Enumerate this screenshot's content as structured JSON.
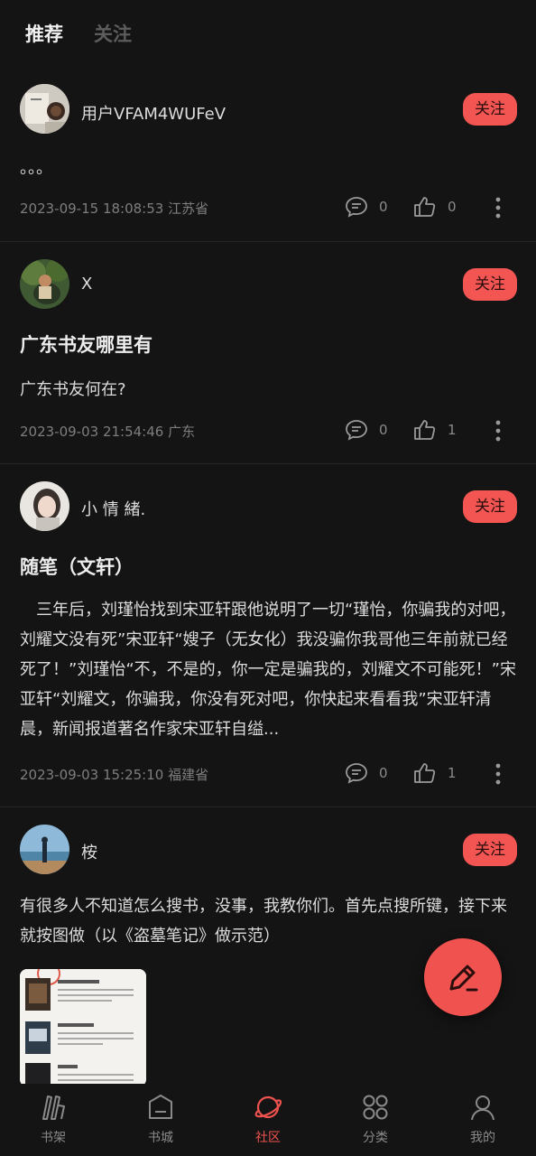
{
  "tabs": {
    "recommend": "推荐",
    "follow": "关注"
  },
  "follow_label": "关注",
  "posts": [
    {
      "user": "用户VFAM4WUFeV",
      "body": "。。。",
      "time": "2023-09-15 18:08:53 江苏省",
      "comments": "0",
      "likes": "0"
    },
    {
      "user": "X",
      "title": "广东书友哪里有",
      "body": "广东书友何在?",
      "time": "2023-09-03 21:54:46 广东",
      "comments": "0",
      "likes": "1"
    },
    {
      "user": "小 情 緒.",
      "title": "随笔（文轩）",
      "body": "　三年后，刘瑾怡找到宋亚轩跟他说明了一切“瑾怡，你骗我的对吧，刘耀文没有死”宋亚轩“嫂子（无女化）我没骗你我哥他三年前就已经死了！”刘瑾怡“不，不是的，你一定是骗我的，刘耀文不可能死！”宋亚轩“刘耀文，你骗我，你没有死对吧，你快起来看看我”宋亚轩清晨，新闻报道著名作家宋亚轩自缢...",
      "time": "2023-09-03 15:25:10 福建省",
      "comments": "0",
      "likes": "1"
    },
    {
      "user": "桉",
      "body": "有很多人不知道怎么搜书，没事，我教你们。首先点搜所键，接下来就按图做（以《盗墓笔记》做示范）"
    }
  ],
  "nav": [
    {
      "label": "书架",
      "icon": "bookshelf-icon"
    },
    {
      "label": "书城",
      "icon": "bookstore-icon"
    },
    {
      "label": "社区",
      "icon": "planet-icon"
    },
    {
      "label": "分类",
      "icon": "category-icon"
    },
    {
      "label": "我的",
      "icon": "profile-icon"
    }
  ],
  "colors": {
    "accent": "#f0534f",
    "background": "#141414",
    "follow_button": "#f25552"
  }
}
